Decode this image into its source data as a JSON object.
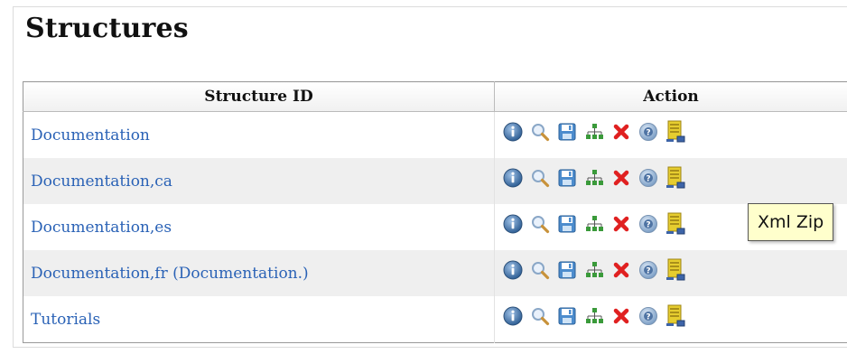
{
  "page": {
    "title": "Structures"
  },
  "table": {
    "headers": {
      "structure_id": "Structure ID",
      "action": "Action"
    },
    "rows": [
      {
        "id": "Documentation"
      },
      {
        "id": "Documentation,ca"
      },
      {
        "id": "Documentation,es"
      },
      {
        "id": "Documentation,fr (Documentation.)"
      },
      {
        "id": "Tutorials"
      }
    ],
    "action_icons": [
      "info-icon",
      "search-icon",
      "save-icon",
      "tree-icon",
      "delete-icon",
      "help-icon",
      "xml-zip-icon"
    ]
  },
  "tooltip": {
    "text": "Xml Zip"
  },
  "colors": {
    "link": "#2a62b6",
    "delete": "#e02020",
    "info": "#3f6f9f",
    "tooltip_bg": "#ffffcc"
  }
}
